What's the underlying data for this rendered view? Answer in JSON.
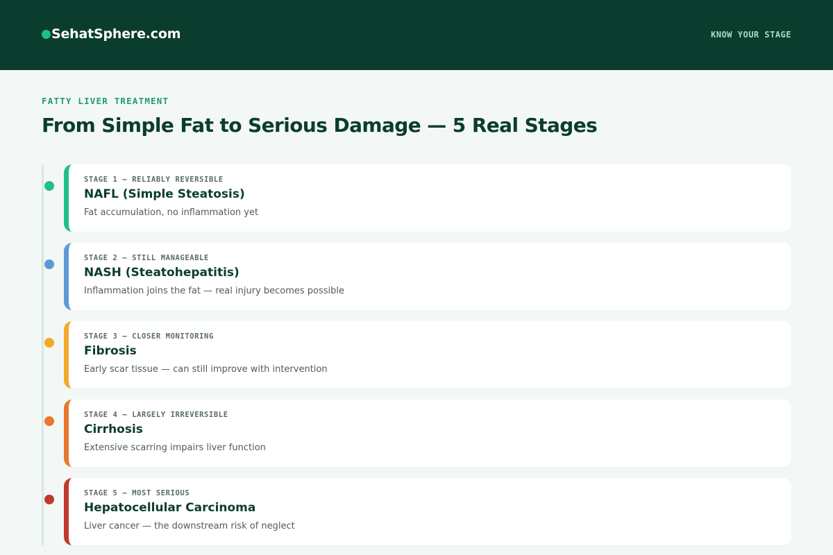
{
  "header": {
    "brand": "SehatSphere.com",
    "nav_link": "KNOW YOUR STAGE"
  },
  "main": {
    "eyebrow": "FATTY LIVER TREATMENT",
    "title": "From Simple Fat to Serious Damage — 5 Real Stages"
  },
  "colors": {
    "header_bg": "#0a3d2e",
    "brand_dot": "#1dbf84",
    "stage1": "#22c088",
    "stage2": "#5b9bd5",
    "stage3": "#f2a92b",
    "stage4": "#e8772e",
    "stage5": "#c0392b"
  },
  "stages": [
    {
      "tag": "STAGE 1 — RELIABLY REVERSIBLE",
      "title": "NAFL (Simple Steatosis)",
      "description": "Fat accumulation, no inflammation yet"
    },
    {
      "tag": "STAGE 2 — STILL MANAGEABLE",
      "title": "NASH (Steatohepatitis)",
      "description": "Inflammation joins the fat — real injury becomes possible"
    },
    {
      "tag": "STAGE 3 — CLOSER MONITORING",
      "title": "Fibrosis",
      "description": "Early scar tissue — can still improve with intervention"
    },
    {
      "tag": "STAGE 4 — LARGELY IRREVERSIBLE",
      "title": "Cirrhosis",
      "description": "Extensive scarring impairs liver function"
    },
    {
      "tag": "STAGE 5 — MOST SERIOUS",
      "title": "Hepatocellular Carcinoma",
      "description": "Liver cancer — the downstream risk of neglect"
    }
  ]
}
